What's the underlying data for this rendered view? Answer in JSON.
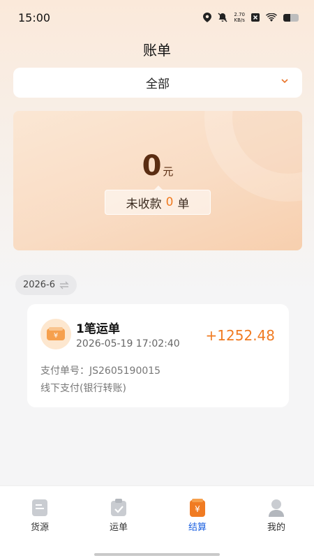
{
  "status": {
    "time": "15:00",
    "speed_value": "2.70",
    "speed_unit": "KB/s"
  },
  "page": {
    "title": "账单"
  },
  "filter": {
    "selected": "全部"
  },
  "summary": {
    "amount": "0",
    "amount_unit": "元",
    "unpaid_prefix": "未收款",
    "unpaid_count": "0",
    "unpaid_suffix": "单"
  },
  "month": {
    "label": "2026-6"
  },
  "bills": [
    {
      "name": "1笔运单",
      "time": "2026-05-19 17:02:40",
      "amount": "+1252.48",
      "pay_no": "支付单号：JS2605190015",
      "method": "线下支付(银行转账)"
    }
  ],
  "tabs": [
    {
      "label": "货源",
      "icon": "document-icon"
    },
    {
      "label": "运单",
      "icon": "clipboard-check-icon"
    },
    {
      "label": "结算",
      "icon": "yuan-bill-icon"
    },
    {
      "label": "我的",
      "icon": "person-icon"
    }
  ],
  "active_tab": "结算",
  "colors": {
    "accent": "#f07b22",
    "active_tab": "#1a5fe0",
    "amount_dark": "#5a2d12"
  }
}
